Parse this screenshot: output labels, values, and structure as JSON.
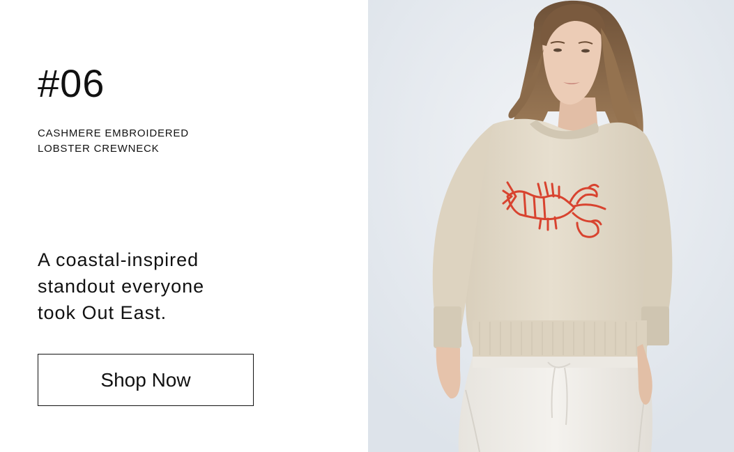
{
  "feature": {
    "number": "#06",
    "product_name_lines": [
      "CASHMERE EMBROIDERED",
      "LOBSTER CREWNECK"
    ],
    "tagline_lines": [
      "A coastal-inspired",
      "standout everyone",
      "took Out East."
    ],
    "cta_label": "Shop Now"
  },
  "image": {
    "subject": "model wearing cream cashmere crewneck sweater with red embroidered lobster",
    "colors": {
      "background": "#e6eaf0",
      "sweater": "#e3dac8",
      "embroidery": "#d8432f",
      "pants": "#f1efea",
      "hair": "#8a6a4c",
      "skin": "#e8c7b0"
    }
  }
}
